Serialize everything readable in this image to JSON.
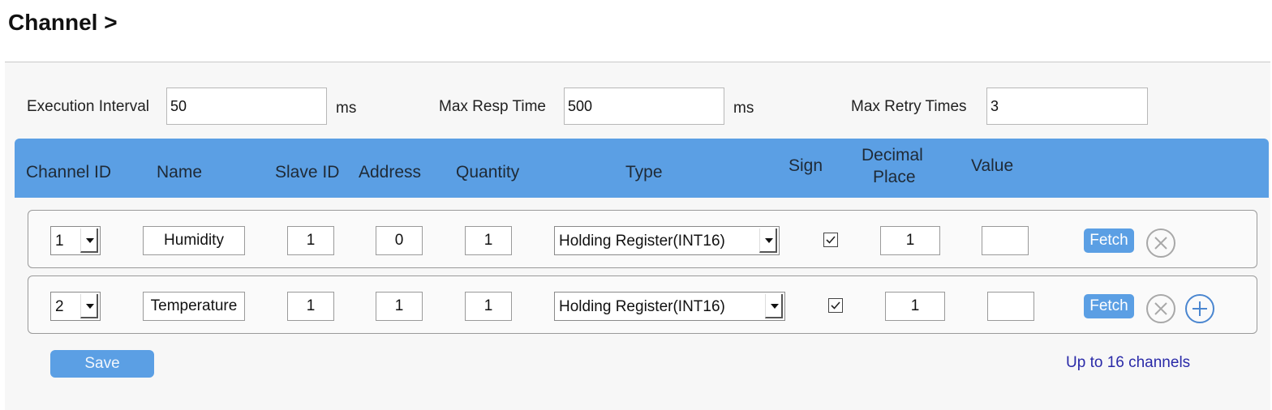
{
  "page": {
    "title": "Channel >"
  },
  "settings": {
    "execution_interval": {
      "label": "Execution Interval",
      "value": "50",
      "unit": "ms"
    },
    "max_resp_time": {
      "label": "Max Resp Time",
      "value": "500",
      "unit": "ms"
    },
    "max_retry_times": {
      "label": "Max Retry Times",
      "value": "3"
    }
  },
  "table": {
    "headers": {
      "channel_id": "Channel ID",
      "name": "Name",
      "slave_id": "Slave ID",
      "address": "Address",
      "quantity": "Quantity",
      "type": "Type",
      "sign": "Sign",
      "decimal_place_1": "Decimal",
      "decimal_place_2": "Place",
      "value": "Value"
    },
    "rows": [
      {
        "channel_id": "1",
        "name": "Humidity",
        "slave_id": "1",
        "address": "0",
        "quantity": "1",
        "type": "Holding Register(INT16)",
        "sign": true,
        "decimal_place": "1",
        "value": "",
        "fetch_label": "Fetch"
      },
      {
        "channel_id": "2",
        "name": "Temperature",
        "slave_id": "1",
        "address": "1",
        "quantity": "1",
        "type": "Holding Register(INT16)",
        "sign": true,
        "decimal_place": "1",
        "value": "",
        "fetch_label": "Fetch"
      }
    ]
  },
  "footer": {
    "save_label": "Save",
    "hint": "Up to 16 channels"
  },
  "colors": {
    "accent": "#5b9fe4",
    "hint_text": "#2a2aa8",
    "icon_circle": "#9a9a9a",
    "add_icon": "#4a86d0"
  },
  "icons": {
    "remove": "close-circle-icon",
    "add": "plus-circle-icon",
    "dropdown": "chevron-down-icon",
    "check": "check-icon"
  }
}
